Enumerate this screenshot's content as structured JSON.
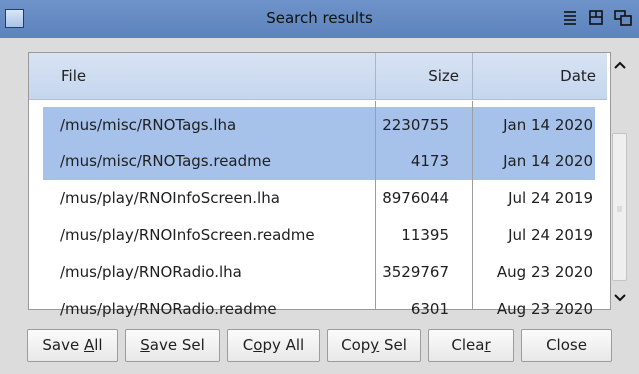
{
  "window": {
    "title": "Search results"
  },
  "columns": {
    "file": "File",
    "size": "Size",
    "date": "Date"
  },
  "rows": [
    {
      "file": "/mus/misc/RNOTags.lha",
      "size": "2230755",
      "date": "Jan 14  2020",
      "selected": true
    },
    {
      "file": "/mus/misc/RNOTags.readme",
      "size": "4173",
      "date": "Jan 14  2020",
      "selected": true
    },
    {
      "file": "/mus/play/RNOInfoScreen.lha",
      "size": "8976044",
      "date": "Jul 24  2019",
      "selected": false
    },
    {
      "file": "/mus/play/RNOInfoScreen.readme",
      "size": "11395",
      "date": "Jul 24  2019",
      "selected": false
    },
    {
      "file": "/mus/play/RNORadio.lha",
      "size": "3529767",
      "date": "Aug 23  2020",
      "selected": false
    },
    {
      "file": "/mus/play/RNORadio.readme",
      "size": "6301",
      "date": "Aug 23  2020",
      "selected": false
    }
  ],
  "buttons": {
    "save_all": {
      "pre": "Save ",
      "key": "A",
      "post": "ll"
    },
    "save_sel": {
      "pre": "",
      "key": "S",
      "post": "ave Sel"
    },
    "copy_all": {
      "pre": "C",
      "key": "o",
      "post": "py All"
    },
    "copy_sel": {
      "pre": "Cop",
      "key": "y",
      "post": " Sel"
    },
    "clear": {
      "pre": "Clea",
      "key": "r",
      "post": ""
    },
    "close": {
      "pre": "Close",
      "key": "",
      "post": ""
    }
  },
  "icons": {
    "title_close": "close-gadget-icon",
    "menu": "menu-icon",
    "iconify": "iconify-icon",
    "depth": "depth-icon",
    "scroll_up": "arrow-up-icon",
    "scroll_down": "arrow-down-icon"
  },
  "colors": {
    "titlebar": "#6389c2",
    "header": "#cddbf0",
    "selection": "#a6c2eb"
  }
}
